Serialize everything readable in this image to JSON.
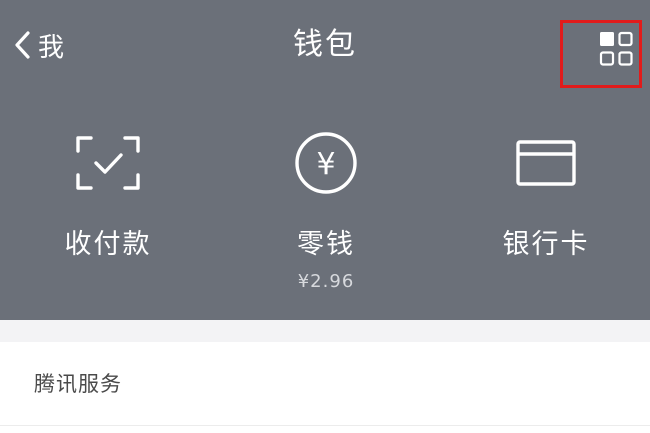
{
  "header": {
    "back_label": "我",
    "title": "钱包"
  },
  "features": [
    {
      "label": "收付款",
      "icon": "scan-pay-icon"
    },
    {
      "label": "零钱",
      "sub": "¥2.96",
      "icon": "yuan-circle-icon"
    },
    {
      "label": "银行卡",
      "icon": "bank-card-icon"
    }
  ],
  "section": {
    "title": "腾讯服务"
  },
  "colors": {
    "header_bg": "#6b7079",
    "highlight_border": "#e21b1b"
  }
}
